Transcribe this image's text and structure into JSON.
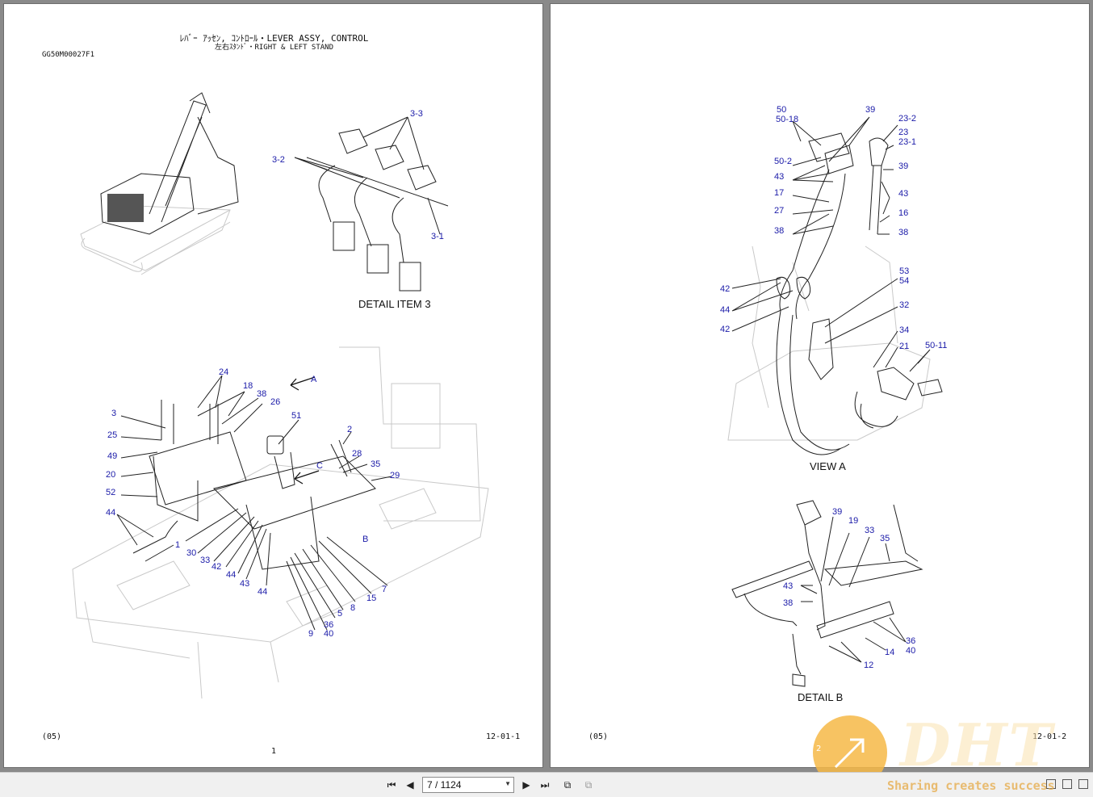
{
  "left_page": {
    "title_line1": "ﾚﾊﾞｰ ｱｯｾﾝ, ｺﾝﾄﾛｰﾙ・LEVER ASSY, CONTROL",
    "title_line2": "左右ｽﾀﾝﾄﾞ・RIGHT & LEFT STAND",
    "doc_id": "GG50M00027F1",
    "detail_caption": "DETAIL ITEM 3",
    "footer_rev": "(05)",
    "footer_code": "12-01-1",
    "page_number": "1",
    "detail3_labels": [
      "3-3",
      "3-2",
      "3-1"
    ],
    "main_labels": [
      "24",
      "18",
      "38",
      "26",
      "A",
      "3",
      "51",
      "2",
      "25",
      "28",
      "49",
      "C",
      "35",
      "20",
      "29",
      "52",
      "44",
      "1",
      "B",
      "30",
      "33",
      "42",
      "44",
      "43",
      "44",
      "7",
      "15",
      "8",
      "5",
      "36",
      "40",
      "9"
    ]
  },
  "right_page": {
    "view_a_caption": "VIEW A",
    "detail_b_caption": "DETAIL  B",
    "footer_rev": "(05)",
    "footer_code": "12-01-2",
    "view_a_labels": [
      "50",
      "50-18",
      "39",
      "23-2",
      "23",
      "23-1",
      "50-2",
      "39",
      "43",
      "43",
      "17",
      "16",
      "27",
      "38",
      "38",
      "53",
      "54",
      "42",
      "44",
      "42",
      "32",
      "34",
      "21",
      "50-11"
    ],
    "detail_b_labels": [
      "39",
      "19",
      "33",
      "35",
      "43",
      "38",
      "36",
      "40",
      "14",
      "12"
    ]
  },
  "toolbar": {
    "page_field": "7 / 1124",
    "icons": [
      "first-page-icon",
      "prev-page-icon",
      "next-page-icon",
      "last-page-icon",
      "fit-page-icon",
      "fit-width-icon"
    ]
  },
  "watermark": {
    "badge_number": "2",
    "logo": "DHT",
    "slogan": "Sharing creates success"
  }
}
